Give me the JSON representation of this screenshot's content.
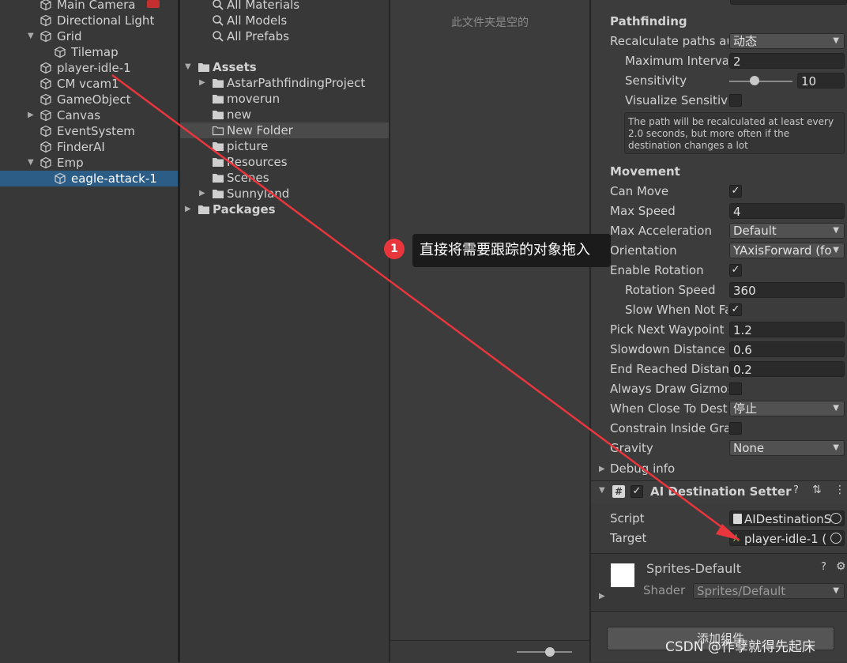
{
  "hierarchy": {
    "items": [
      {
        "label": "Main Camera",
        "indent": 0,
        "arrow": false,
        "selected": false
      },
      {
        "label": "Directional Light",
        "indent": 0,
        "arrow": false,
        "selected": false
      },
      {
        "label": "Grid",
        "indent": 0,
        "arrow": "down",
        "selected": false
      },
      {
        "label": "Tilemap",
        "indent": 1,
        "arrow": false,
        "selected": false
      },
      {
        "label": "player-idle-1",
        "indent": 0,
        "arrow": false,
        "selected": false
      },
      {
        "label": "CM vcam1",
        "indent": 0,
        "arrow": false,
        "selected": false
      },
      {
        "label": "GameObject",
        "indent": 0,
        "arrow": false,
        "selected": false
      },
      {
        "label": "Canvas",
        "indent": 0,
        "arrow": "right",
        "selected": false
      },
      {
        "label": "EventSystem",
        "indent": 0,
        "arrow": false,
        "selected": false
      },
      {
        "label": "FinderAI",
        "indent": 0,
        "arrow": false,
        "selected": false
      },
      {
        "label": "Emp",
        "indent": 0,
        "arrow": "down",
        "selected": false
      },
      {
        "label": "eagle-attack-1",
        "indent": 1,
        "arrow": false,
        "selected": true
      }
    ]
  },
  "project": {
    "search_items": [
      "All Materials",
      "All Models",
      "All Prefabs"
    ],
    "assets_label": "Assets",
    "folders": [
      {
        "label": "AstarPathfindingProject",
        "arrow": true,
        "highlight": false,
        "open": false
      },
      {
        "label": "moverun",
        "arrow": false,
        "highlight": false,
        "open": false
      },
      {
        "label": "new",
        "arrow": false,
        "highlight": false,
        "open": false
      },
      {
        "label": "New Folder",
        "arrow": false,
        "highlight": true,
        "open": true
      },
      {
        "label": "picture",
        "arrow": false,
        "highlight": false,
        "open": false
      },
      {
        "label": "Resources",
        "arrow": false,
        "highlight": false,
        "open": false
      },
      {
        "label": "Scenes",
        "arrow": false,
        "highlight": false,
        "open": false
      },
      {
        "label": "Sunnyland",
        "arrow": true,
        "highlight": false,
        "open": false
      }
    ],
    "packages_label": "Packages",
    "empty_message": "此文件夹是空的"
  },
  "inspector": {
    "pathfinding_header": "Pathfinding",
    "recalc_label": "Recalculate paths au",
    "recalc_value": "动态",
    "max_interval_label": "Maximum Interva",
    "max_interval_value": "2",
    "sensitivity_label": "Sensitivity",
    "sensitivity_value": "10",
    "sensitivity_level": 0.4,
    "visualize_label": "Visualize Sensitivi",
    "visualize_checked": false,
    "help_text": "The path will be recalculated at least every 2.0 seconds, but more often if the destination changes a lot",
    "movement_header": "Movement",
    "can_move_label": "Can Move",
    "can_move_checked": true,
    "max_speed_label": "Max Speed",
    "max_speed_value": "4",
    "max_accel_label": "Max Acceleration",
    "max_accel_value": "Default",
    "orientation_label": "Orientation",
    "orientation_value": "YAxisForward (fo",
    "enable_rotation_label": "Enable Rotation",
    "enable_rotation_checked": true,
    "rotation_speed_label": "Rotation Speed",
    "rotation_speed_value": "360",
    "slow_when_label": "Slow When Not Fa",
    "slow_when_checked": true,
    "pick_next_label": "Pick Next Waypoint",
    "pick_next_value": "1.2",
    "slowdown_label": "Slowdown Distance",
    "slowdown_value": "0.6",
    "end_reached_label": "End Reached Distan",
    "end_reached_value": "0.2",
    "always_draw_label": "Always Draw Gizmos",
    "always_draw_checked": false,
    "when_close_label": "When Close To Dest",
    "when_close_value": "停止",
    "constrain_label": "Constrain Inside Gra",
    "constrain_checked": false,
    "gravity_label": "Gravity",
    "gravity_value": "None",
    "debug_label": "Debug info",
    "component_title": "AI Destination Setter",
    "script_label": "Script",
    "script_value": "AIDestinationS",
    "target_label": "Target",
    "target_value": "player-idle-1 (",
    "material_name": "Sprites-Default",
    "shader_label": "Shader",
    "shader_value": "Sprites/Default",
    "add_component": "添加组件"
  },
  "annotation": {
    "badge": "1",
    "text": "直接将需要跟踪的对象拖入",
    "arrow_color": "#e8363c"
  },
  "watermark": "CSDN @作孽就得先起床"
}
